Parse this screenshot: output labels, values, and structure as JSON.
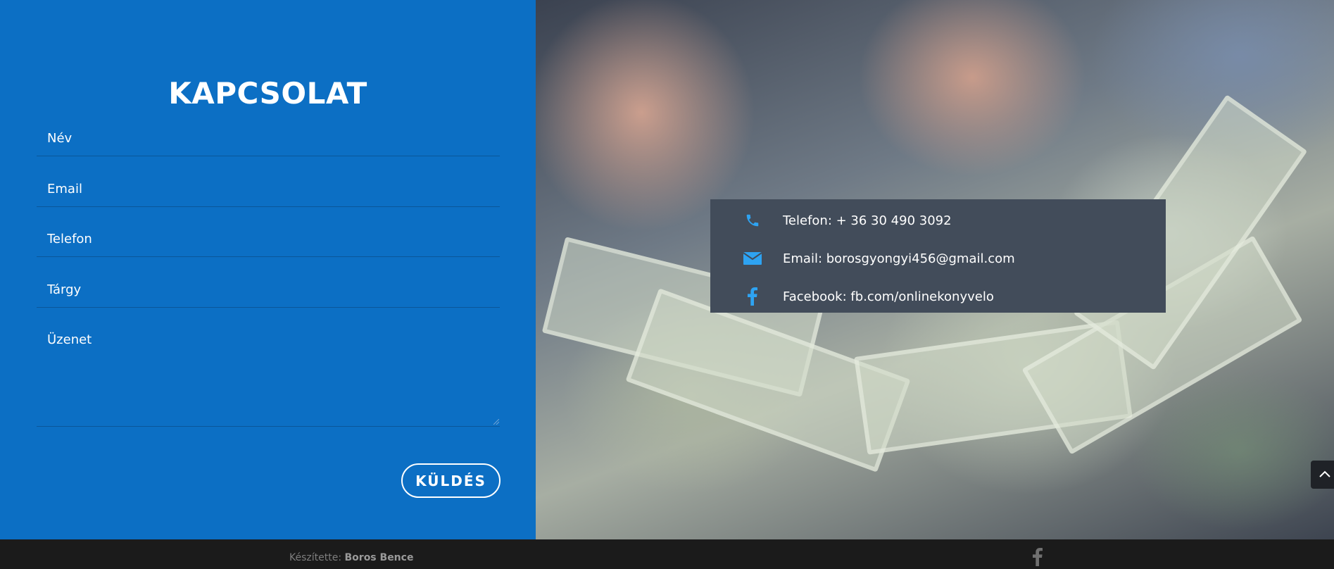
{
  "contact_form": {
    "title": "KAPCSOLAT",
    "fields": {
      "name_placeholder": "Név",
      "email_placeholder": "Email",
      "phone_placeholder": "Telefon",
      "subject_placeholder": "Tárgy",
      "message_placeholder": "Üzenet"
    },
    "submit_label": "KÜLDÉS"
  },
  "contact_info": {
    "phone": {
      "icon": "phone-icon",
      "text": "Telefon: + 36 30 490 3092"
    },
    "email": {
      "icon": "envelope-icon",
      "text": "Email: borosgyongyi456@gmail.com"
    },
    "facebook": {
      "icon": "facebook-icon",
      "text": "Facebook: fb.com/onlinekonyvelo"
    }
  },
  "footer": {
    "credit_prefix": "Készítette:",
    "credit_name": "Boros Bence",
    "social_icon": "facebook-icon"
  },
  "colors": {
    "form_background": "#0c6fc4",
    "info_box_background": "#424c5a",
    "icon_accent": "#2ea3f2",
    "footer_background": "#1b1b1b"
  }
}
